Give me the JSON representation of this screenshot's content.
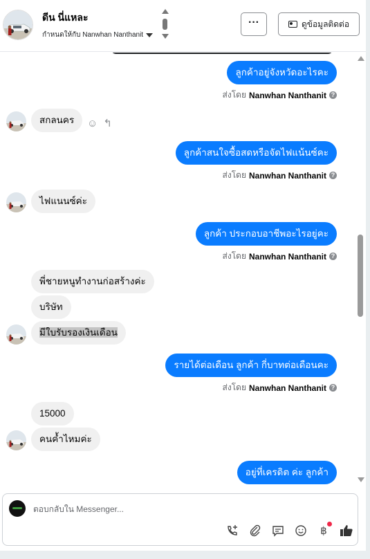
{
  "header": {
    "contact_name": "ดีน นี่แหละ",
    "assigned_label": "กำหนดให้กับ Nanwhan Nanthanit",
    "more_label": "···",
    "info_button_label": "ดูข้อมูลติดต่อ"
  },
  "messages": {
    "m1": "ลูกค้าอยู่จังหวัดอะไรคะ",
    "m2": "สกลนคร",
    "m3": "ลูกค้าสนใจซื้อสดหรือจัดไฟแน้นซ์คะ",
    "m4": "ไฟแนนซ์ค่ะ",
    "m5": "ลูกค้า ประกอบอาชีพอะไรอยู่คะ",
    "m6": "พี่ชายหนูทำงานก่อสร้างค่ะ",
    "m7": "บริษัท",
    "m8": "มีใบรับรองเงินเดือน",
    "m9": "รายได้ต่อเดือน ลูกค้า กี่บาทต่อเดือนคะ",
    "m10": "15000",
    "m11": "คนค้ำไหมค่ะ",
    "m12": "อยู่ที่เครดิต ค่ะ  ลูกค้า"
  },
  "sent_by": {
    "prefix": "ส่งโดย",
    "agent": "Nanwhan Nanthanit"
  },
  "composer": {
    "placeholder": "ตอบกลับใน Messenger..."
  },
  "colors": {
    "outgoing_bubble": "#0a7cff",
    "incoming_bubble": "#f0f0f0"
  },
  "icons": [
    "more-icon",
    "contact-card-icon",
    "emoji-react-icon",
    "reply-icon",
    "call-add-icon",
    "attach-icon",
    "quick-reply-icon",
    "emoji-icon",
    "baht-icon",
    "thumbs-up-icon"
  ]
}
